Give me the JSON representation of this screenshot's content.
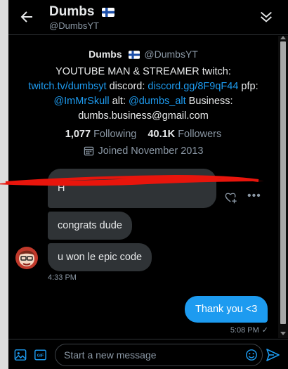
{
  "header": {
    "name": "Dumbs",
    "handle": "@DumbsYT"
  },
  "profile": {
    "name": "Dumbs",
    "handle": "@DumbsYT",
    "bio_1": "YOUTUBE MAN & STREAMER twitch: ",
    "bio_link_twitch": "twitch.tv/dumbsyt",
    "bio_2": " discord: ",
    "bio_link_discord": "discord.gg/8F9qF44",
    "bio_3": " pfp: ",
    "bio_link_pfp": "@ImMrSkull",
    "bio_4": " alt: ",
    "bio_link_alt": "@dumbs_alt",
    "bio_5": " Business: dumbs.business@gmail.com",
    "following_count": "1,077",
    "following_label": "Following",
    "followers_count": "40.1K",
    "followers_label": "Followers",
    "joined": "Joined November 2013"
  },
  "messages": {
    "incoming": [
      "H",
      "congrats dude",
      "u won le epic code"
    ],
    "incoming_time": "4:33 PM",
    "outgoing": "Thank you <3",
    "outgoing_time": "5:08 PM",
    "outgoing_status": "✓"
  },
  "composer": {
    "placeholder": "Start a new message"
  },
  "icons": {
    "back": "back-arrow-icon",
    "collapse": "collapse-chevrons-icon",
    "calendar": "calendar-icon",
    "react": "add-reaction-icon",
    "more": "more-dots-icon",
    "media": "image-icon",
    "gif": "gif-icon",
    "emoji": "emoji-icon",
    "send": "send-icon"
  },
  "colors": {
    "background": "#000000",
    "accent": "#1d9bf0",
    "bubble_in": "#2f3336",
    "muted_text": "#8b98a5",
    "scribble": "#e8150c"
  }
}
